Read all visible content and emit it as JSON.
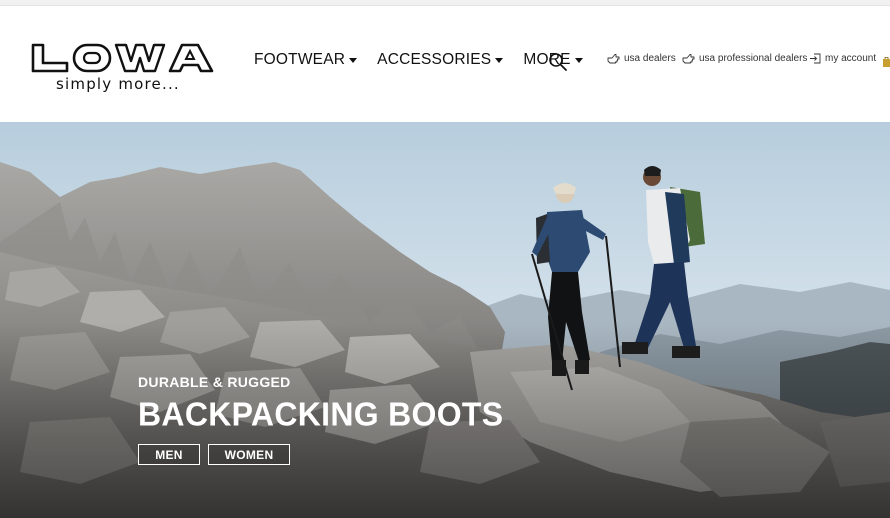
{
  "brand": {
    "logo_text": "LOWA",
    "tagline": "simply more..."
  },
  "nav": {
    "items": [
      {
        "label": "FOOTWEAR"
      },
      {
        "label": "ACCESSORIES"
      },
      {
        "label": "MORE"
      }
    ]
  },
  "utility": {
    "dealers": "usa dealers",
    "pro_dealers": "usa professional dealers",
    "account": "my account"
  },
  "hero": {
    "kicker": "DURABLE & RUGGED",
    "title": "BACKPACKING BOOTS",
    "buttons": {
      "men": "MEN",
      "women": "WOMEN"
    }
  },
  "icons": {
    "nav_caret": "caret-down-icon",
    "search": "search-icon",
    "dealer": "pointing-hand-icon",
    "account": "sign-in-icon",
    "cart": "cart-icon"
  },
  "colors": {
    "text": "#111111",
    "header_bg": "#ffffff",
    "sky": "#c9d8e3",
    "rock": "#8e8c88"
  }
}
